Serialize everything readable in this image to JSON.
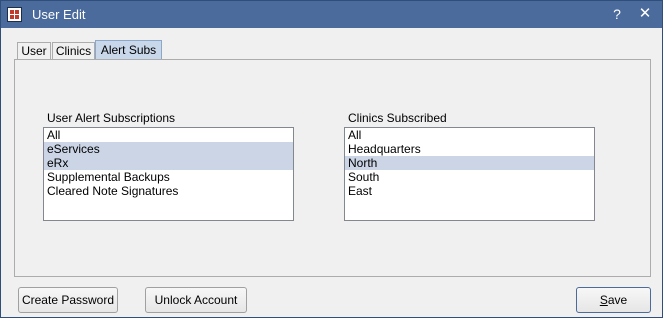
{
  "window": {
    "title": "User Edit",
    "help_glyph": "?",
    "close_glyph": "✕"
  },
  "tabs": [
    {
      "label": "User",
      "active": false
    },
    {
      "label": "Clinics",
      "active": false
    },
    {
      "label": "Alert Subs",
      "active": true
    }
  ],
  "alert_subs": {
    "label": "User Alert Subscriptions",
    "items": [
      {
        "text": "All",
        "selected": false
      },
      {
        "text": "eServices",
        "selected": true
      },
      {
        "text": "eRx",
        "selected": true
      },
      {
        "text": "Supplemental Backups",
        "selected": false
      },
      {
        "text": "Cleared Note Signatures",
        "selected": false
      }
    ]
  },
  "clinics": {
    "label": "Clinics Subscribed",
    "items": [
      {
        "text": "All",
        "selected": false
      },
      {
        "text": "Headquarters",
        "selected": false
      },
      {
        "text": "North",
        "selected": true
      },
      {
        "text": "South",
        "selected": false
      },
      {
        "text": "East",
        "selected": false
      }
    ]
  },
  "buttons": {
    "create_password": "Create Password",
    "unlock_account": "Unlock Account",
    "save_first": "S",
    "save_rest": "ave"
  },
  "colors": {
    "titlebar": "#4a6b9b",
    "selection": "#cbd5e6",
    "active_tab": "#c9d7ea"
  }
}
